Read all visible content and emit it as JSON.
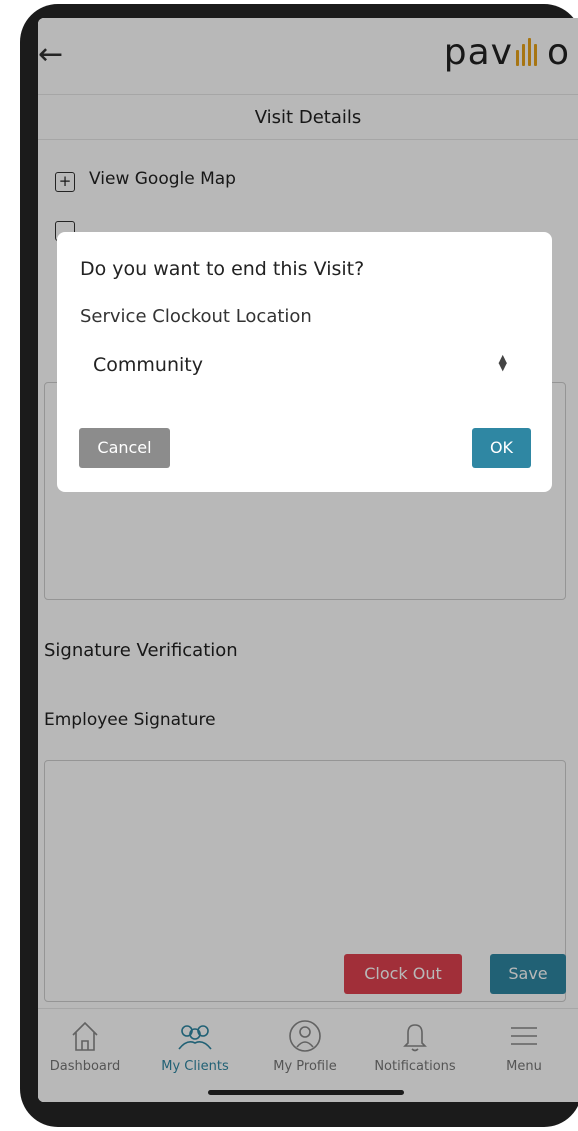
{
  "header": {
    "back_glyph": "←",
    "logo_prefix": "pav",
    "logo_suffix": "o",
    "logo_text": "pavillio",
    "logo_accent_color": "#e8a21a"
  },
  "title": "Visit Details",
  "links": [
    {
      "label": "View Google Map",
      "icon": "plus-icon"
    }
  ],
  "sections": {
    "signature_title": "Signature Verification",
    "employee_signature": "Employee Signature"
  },
  "actions": {
    "clock_out": "Clock Out",
    "save": "Save",
    "clock_out_color": "#e0424f",
    "save_color": "#2f87a3"
  },
  "nav": [
    {
      "label": "Dashboard",
      "icon": "home-icon"
    },
    {
      "label": "My Clients",
      "icon": "clients-icon"
    },
    {
      "label": "My Profile",
      "icon": "profile-icon"
    },
    {
      "label": "Notifications",
      "icon": "bell-icon"
    },
    {
      "label": "Menu",
      "icon": "menu-icon"
    }
  ],
  "nav_active": "My Clients",
  "nav_active_color": "#2f87a3",
  "dialog": {
    "question": "Do you want to end this Visit?",
    "location_label": "Service Clockout Location",
    "location_value": "Community",
    "cancel": "Cancel",
    "ok": "OK"
  }
}
